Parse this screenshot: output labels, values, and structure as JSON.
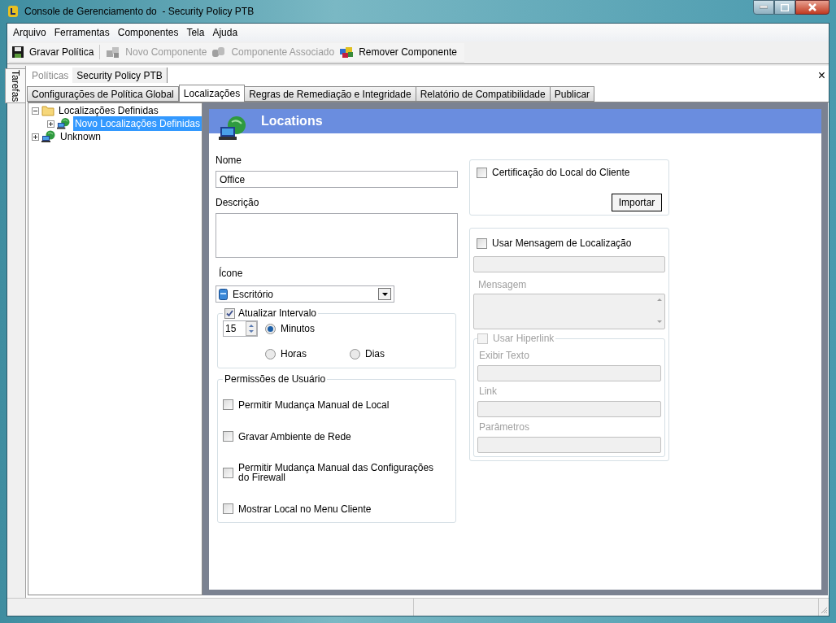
{
  "window": {
    "title": "Console de Gerenciamento do  - Security Policy PTB"
  },
  "menu": [
    "Arquivo",
    "Ferramentas",
    "Componentes",
    "Tela",
    "Ajuda"
  ],
  "toolbar": [
    {
      "kind": "save",
      "label": "Gravar Política",
      "disabled": false
    },
    {
      "kind": "new",
      "label": "Novo Componente",
      "disabled": true
    },
    {
      "kind": "associate",
      "label": "Componente Associado",
      "disabled": true
    },
    {
      "kind": "remove",
      "label": "Remover Componente",
      "disabled": false
    }
  ],
  "side_tab": "Tarefas",
  "breadcrumb": [
    {
      "label": "Políticas",
      "selected": false
    },
    {
      "label": "Security Policy PTB",
      "selected": true
    }
  ],
  "close_glyph": "×",
  "tabs": [
    {
      "label": "Configurações de Política Global",
      "selected": false
    },
    {
      "label": "Localizações",
      "selected": true
    },
    {
      "label": "Regras de Remediação e Integridade",
      "selected": false
    },
    {
      "label": "Relatório de Compatibilidade",
      "selected": false
    },
    {
      "label": "Publicar",
      "selected": false
    }
  ],
  "tree": [
    {
      "kind": "folder",
      "label": "Localizações Definidas",
      "expanded": true,
      "selected": false,
      "children": [
        {
          "kind": "location",
          "label": "Novo Localizações Definidas",
          "expanded": false,
          "selected": true
        }
      ]
    },
    {
      "kind": "location",
      "label": "Unknown",
      "expanded": false,
      "selected": false
    }
  ],
  "panel": {
    "title": "Locations",
    "name": {
      "label": "Nome",
      "value": "Office"
    },
    "description": {
      "label": "Descrição"
    },
    "icon": {
      "label": "Ícone",
      "value": "Escritório"
    },
    "update_interval": {
      "label": "Atualizar Intervalo",
      "checked": true,
      "value": "15",
      "units": [
        {
          "label": "Minutos",
          "selected": true
        },
        {
          "label": "Horas",
          "selected": false
        },
        {
          "label": "Dias",
          "selected": false
        }
      ]
    },
    "permissions": {
      "title": "Permissões de Usuário",
      "items": [
        {
          "label": "Permitir Mudança Manual de Local",
          "checked": false
        },
        {
          "label": "Gravar Ambiente de Rede",
          "checked": false
        },
        {
          "label": "Permitir Mudança Manual das Configurações do Firewall",
          "checked": false
        },
        {
          "label": "Mostrar Local no Menu Cliente",
          "checked": false
        }
      ]
    },
    "certification": {
      "label": "Certificação do Local do Cliente",
      "checked": false,
      "button": "Importar"
    },
    "message": {
      "label": "Usar Mensagem de Localização",
      "checked": false,
      "disabled": true,
      "message_label": "Mensagem",
      "hyperlink": {
        "label": "Usar Hiperlink",
        "checked": false,
        "fields": [
          "Exibir Texto",
          "Link",
          "Parâmetros"
        ]
      }
    }
  }
}
